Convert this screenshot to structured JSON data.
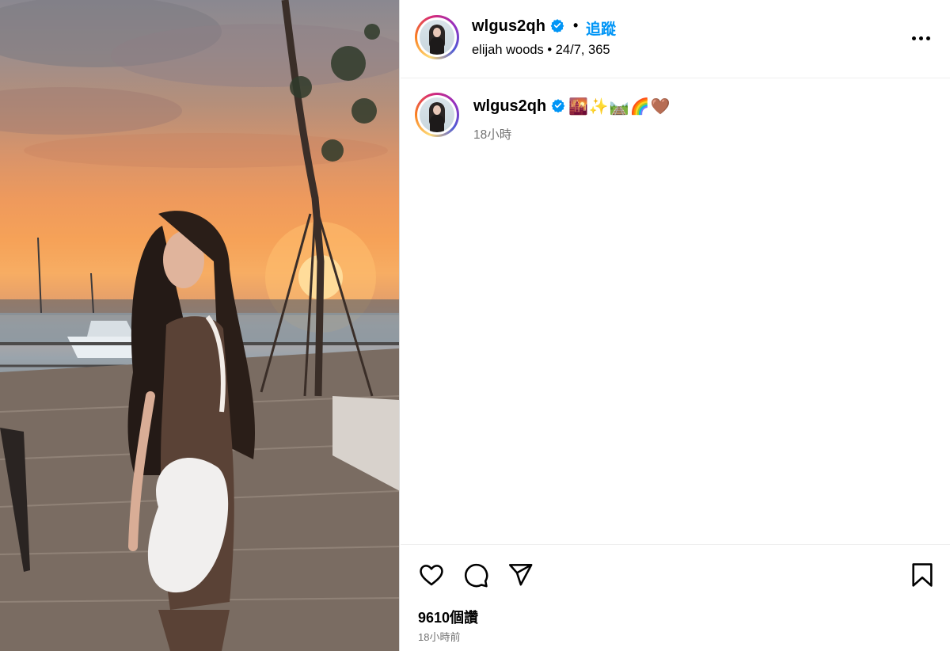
{
  "post": {
    "username": "wlgus2qh",
    "follow_label": "追蹤",
    "dot": "•",
    "subtitle": "elijah woods • 24/7, 365",
    "caption_emoji": "🌇✨🛤️🌈🤎",
    "caption_time": "18小時",
    "likes": "9610個讚",
    "posted_ago": "18小時前"
  },
  "colors": {
    "accent": "#0095f6",
    "verified": "#0095f6",
    "muted_text": "#737373",
    "divider": "#efefef"
  },
  "icons": {
    "like": "heart-icon",
    "comment": "comment-icon",
    "share": "share-icon",
    "save": "bookmark-icon",
    "more": "more-horizontal-icon",
    "verified": "verified-badge-icon"
  }
}
